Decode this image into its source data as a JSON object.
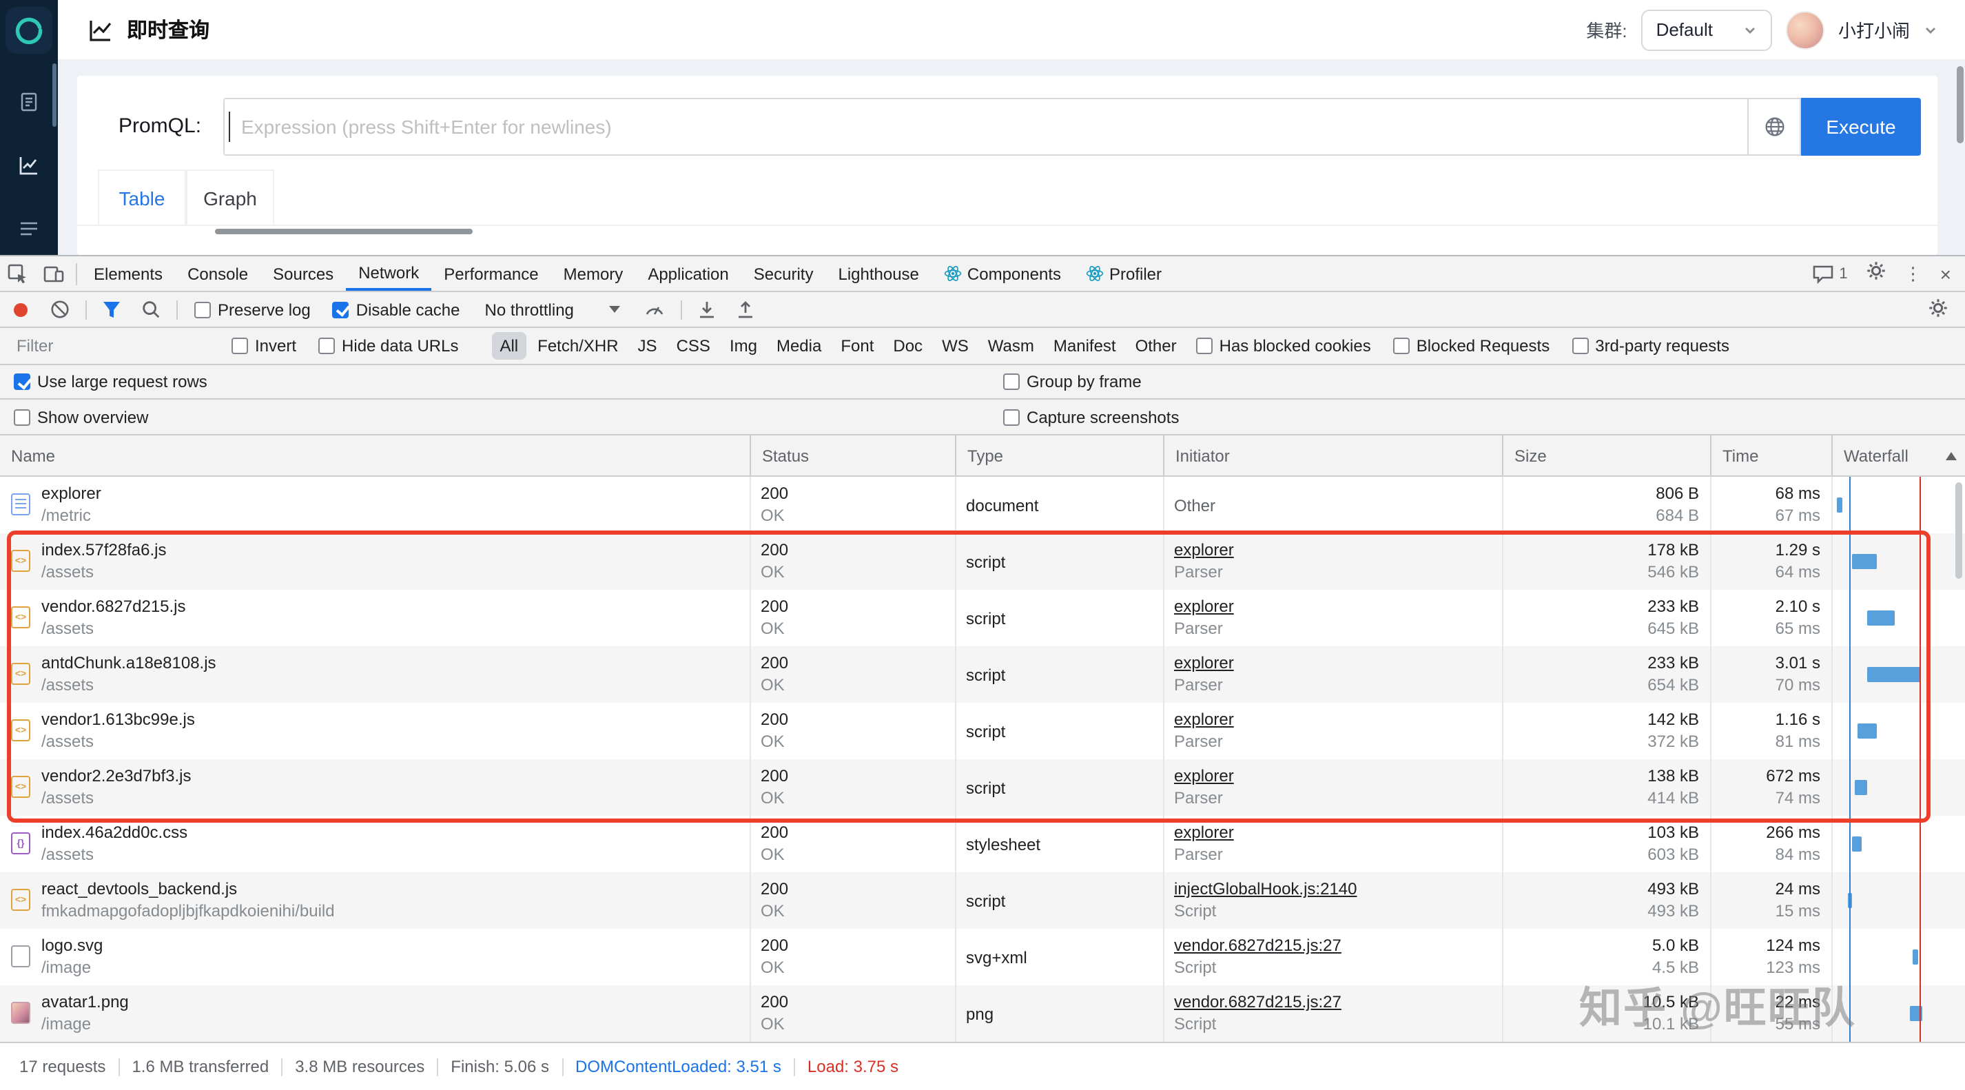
{
  "app": {
    "title": "即时查询",
    "cluster_label": "集群:",
    "cluster_value": "Default",
    "username": "小打小闹",
    "promql": {
      "label": "PromQL:",
      "value": "",
      "placeholder": "Expression (press Shift+Enter for newlines)",
      "execute": "Execute"
    },
    "tabs": {
      "table": "Table",
      "graph": "Graph"
    }
  },
  "devtools": {
    "tabs": [
      "Elements",
      "Console",
      "Sources",
      "Network",
      "Performance",
      "Memory",
      "Application",
      "Security",
      "Lighthouse",
      "Components",
      "Profiler"
    ],
    "active_tab": "Network",
    "issues_count": "1",
    "toolbar": {
      "preserve_log": "Preserve log",
      "disable_cache": "Disable cache",
      "disable_cache_checked": true,
      "preserve_log_checked": false,
      "throttling": "No throttling"
    },
    "filter_bar": {
      "placeholder": "Filter",
      "invert": "Invert",
      "hide_data_urls": "Hide data URLs",
      "types": [
        "All",
        "Fetch/XHR",
        "JS",
        "CSS",
        "Img",
        "Media",
        "Font",
        "Doc",
        "WS",
        "Wasm",
        "Manifest",
        "Other"
      ],
      "selected_type": "All",
      "has_blocked_cookies": "Has blocked cookies",
      "blocked_requests": "Blocked Requests",
      "third_party_requests": "3rd-party requests"
    },
    "options": {
      "use_large_request_rows": "Use large request rows",
      "use_large_request_rows_checked": true,
      "group_by_frame": "Group by frame",
      "show_overview": "Show overview",
      "capture_screenshots": "Capture screenshots"
    },
    "table": {
      "columns": [
        "Name",
        "Status",
        "Type",
        "Initiator",
        "Size",
        "Time",
        "Waterfall"
      ],
      "rows": [
        {
          "icon": "document",
          "name": "explorer",
          "path": "/metric",
          "status": "200",
          "status_sub": "OK",
          "type": "document",
          "initiator": "Other",
          "initiator_sub": "",
          "initiator_link": false,
          "size": "806 B",
          "size_sub": "684 B",
          "time": "68 ms",
          "time_sub": "67 ms",
          "waterfall": {
            "x": 4,
            "w": 4
          }
        },
        {
          "icon": "script",
          "name": "index.57f28fa6.js",
          "path": "/assets",
          "status": "200",
          "status_sub": "OK",
          "type": "script",
          "initiator": "explorer",
          "initiator_sub": "Parser",
          "initiator_link": true,
          "size": "178 kB",
          "size_sub": "546 kB",
          "time": "1.29 s",
          "time_sub": "64 ms",
          "waterfall": {
            "x": 15,
            "w": 18
          }
        },
        {
          "icon": "script",
          "name": "vendor.6827d215.js",
          "path": "/assets",
          "status": "200",
          "status_sub": "OK",
          "type": "script",
          "initiator": "explorer",
          "initiator_sub": "Parser",
          "initiator_link": true,
          "size": "233 kB",
          "size_sub": "645 kB",
          "time": "2.10 s",
          "time_sub": "65 ms",
          "waterfall": {
            "x": 26,
            "w": 20
          }
        },
        {
          "icon": "script",
          "name": "antdChunk.a18e8108.js",
          "path": "/assets",
          "status": "200",
          "status_sub": "OK",
          "type": "script",
          "initiator": "explorer",
          "initiator_sub": "Parser",
          "initiator_link": true,
          "size": "233 kB",
          "size_sub": "654 kB",
          "time": "3.01 s",
          "time_sub": "70 ms",
          "waterfall": {
            "x": 26,
            "w": 39
          }
        },
        {
          "icon": "script",
          "name": "vendor1.613bc99e.js",
          "path": "/assets",
          "status": "200",
          "status_sub": "OK",
          "type": "script",
          "initiator": "explorer",
          "initiator_sub": "Parser",
          "initiator_link": true,
          "size": "142 kB",
          "size_sub": "372 kB",
          "time": "1.16 s",
          "time_sub": "81 ms",
          "waterfall": {
            "x": 19,
            "w": 14
          }
        },
        {
          "icon": "script",
          "name": "vendor2.2e3d7bf3.js",
          "path": "/assets",
          "status": "200",
          "status_sub": "OK",
          "type": "script",
          "initiator": "explorer",
          "initiator_sub": "Parser",
          "initiator_link": true,
          "size": "138 kB",
          "size_sub": "414 kB",
          "time": "672 ms",
          "time_sub": "74 ms",
          "waterfall": {
            "x": 17,
            "w": 9
          }
        },
        {
          "icon": "stylesheet",
          "name": "index.46a2dd0c.css",
          "path": "/assets",
          "status": "200",
          "status_sub": "OK",
          "type": "stylesheet",
          "initiator": "explorer",
          "initiator_sub": "Parser",
          "initiator_link": true,
          "size": "103 kB",
          "size_sub": "603 kB",
          "time": "266 ms",
          "time_sub": "84 ms",
          "waterfall": {
            "x": 15,
            "w": 7
          }
        },
        {
          "icon": "script",
          "name": "react_devtools_backend.js",
          "path": "fmkadmapgofadopljbjfkapdkoienihi/build",
          "status": "200",
          "status_sub": "OK",
          "type": "script",
          "initiator": "injectGlobalHook.js:2140",
          "initiator_sub": "Script",
          "initiator_link": true,
          "size": "493 kB",
          "size_sub": "493 kB",
          "time": "24 ms",
          "time_sub": "15 ms",
          "waterfall": {
            "x": 12,
            "w": 3
          }
        },
        {
          "icon": "file",
          "name": "logo.svg",
          "path": "/image",
          "status": "200",
          "status_sub": "OK",
          "type": "svg+xml",
          "initiator": "vendor.6827d215.js:27",
          "initiator_sub": "Script",
          "initiator_link": true,
          "size": "5.0 kB",
          "size_sub": "4.5 kB",
          "time": "124 ms",
          "time_sub": "123 ms",
          "waterfall": {
            "x": 59,
            "w": 4
          }
        },
        {
          "icon": "image",
          "name": "avatar1.png",
          "path": "/image",
          "status": "200",
          "status_sub": "OK",
          "type": "png",
          "initiator": "vendor.6827d215.js:27",
          "initiator_sub": "Script",
          "initiator_link": true,
          "size": "10.5 kB",
          "size_sub": "10.1 kB",
          "time": "22 ms",
          "time_sub": "55 ms",
          "waterfall": {
            "x": 57,
            "w": 9
          }
        }
      ]
    },
    "summary": {
      "requests": "17 requests",
      "transferred": "1.6 MB transferred",
      "resources": "3.8 MB resources",
      "finish": "Finish: 5.06 s",
      "dcl": "DOMContentLoaded: 3.51 s",
      "load": "Load: 3.75 s"
    }
  },
  "watermark": "知乎 @旺旺队",
  "icons": [
    "n9e-logo",
    "line-chart-icon",
    "chevron-down-icon",
    "globe-icon",
    "inspect-icon",
    "device-toolbar-icon",
    "record-icon",
    "clear-icon",
    "filter-funnel-icon",
    "search-icon",
    "network-conditions-icon",
    "import-har-icon",
    "export-har-icon",
    "issues-bubble-icon",
    "gear-icon",
    "kebab-icon",
    "close-icon",
    "react-icon",
    "sort-asc-icon"
  ],
  "colors": {
    "accent_blue": "#2577e3",
    "devtools_blue": "#1a73e8",
    "load_red": "#d93025",
    "annotation_red": "#ee3e2a",
    "sidebar_bg": "#0e2236",
    "logo_teal": "#2fc7b7"
  }
}
